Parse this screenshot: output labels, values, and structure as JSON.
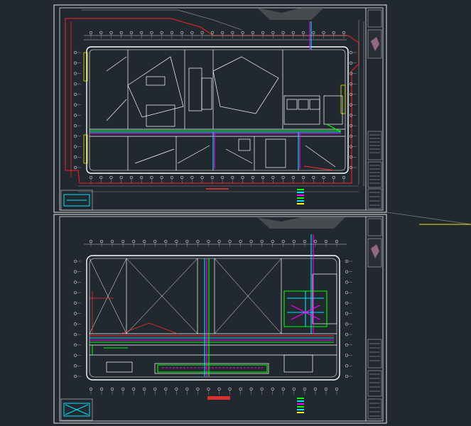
{
  "app": {
    "background": "#212830",
    "sheet_line_color": "#e8e8e8",
    "wall_color": "#ffffff",
    "boundary_color": "#ff2020",
    "grid_color": "#c8c8c8",
    "pipe_colors": [
      "#00e5ff",
      "#ff00ff",
      "#00ff00",
      "#ffff00",
      "#ff3030"
    ],
    "crosshair_color": "#e8e800"
  },
  "sheets": [
    {
      "name": "upper-floor-plan",
      "title_bar_label": ""
    },
    {
      "name": "lower-floor-plan",
      "title_bar_label": ""
    }
  ]
}
